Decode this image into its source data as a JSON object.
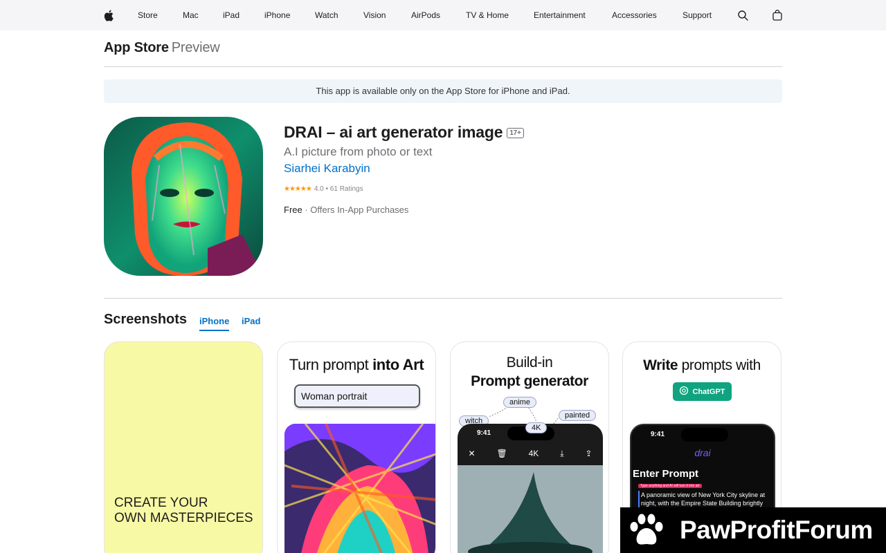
{
  "globalnav": {
    "apple_icon": "apple-logo-icon",
    "items": [
      "Store",
      "Mac",
      "iPad",
      "iPhone",
      "Watch",
      "Vision",
      "AirPods",
      "TV & Home",
      "Entertainment",
      "Accessories",
      "Support"
    ],
    "search_icon": "search-icon",
    "bag_icon": "shopping-bag-icon"
  },
  "localnav": {
    "title": "App Store",
    "subtitle": "Preview"
  },
  "banner": {
    "text": "This app is available only on the App Store for iPhone and iPad."
  },
  "app": {
    "name": "DRAI – ai art generator image",
    "age_rating": "17+",
    "subtitle": "A.I picture from photo or text",
    "developer": "Siarhei Karabyin",
    "stars": "★★★★★",
    "rating_value": 4.0,
    "rating_text": "4.0 • 61 Ratings",
    "price": "Free",
    "iap": "Offers In-App Purchases"
  },
  "screenshots": {
    "title": "Screenshots",
    "tabs": [
      {
        "label": "iPhone",
        "active": true
      },
      {
        "label": "iPad",
        "active": false
      }
    ],
    "shot1": {
      "text_line1": "CREATE YOUR",
      "text_line2": "OWN MASTERPIECES"
    },
    "shot2": {
      "head_a": "Turn prompt ",
      "head_b": "into Art",
      "input": "Woman portrait"
    },
    "shot3": {
      "head_a": "Build-in",
      "head_b": "Prompt generator",
      "chips": [
        "anime",
        "witch",
        "painted",
        "4K"
      ],
      "time": "9:41",
      "toolbar": [
        "✕",
        "🗑",
        "4K",
        "⤓",
        "⇪"
      ]
    },
    "shot4": {
      "head_a": "Write",
      "head_b": " prompts with",
      "button": "ChatGPT",
      "time": "9:41",
      "brand": "drai",
      "screen_title": "Enter Prompt",
      "tag": "Type anything and AI will turn it into art",
      "prompt": "A panoramic view of New York City skyline at night, with the Empire State Building brightly"
    }
  },
  "watermark": {
    "text": "PawProfitForum",
    "icon": "paw-icon"
  }
}
